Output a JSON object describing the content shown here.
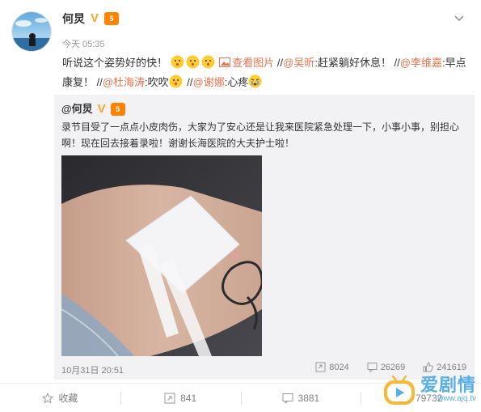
{
  "post": {
    "username": "何炅",
    "level_badge": "5",
    "time": "今天 05:35",
    "text_part1": "听说这个姿势好的快！",
    "view_pic": "查看图片",
    "seg2_prefix": " //",
    "mention1": "@吴昕",
    "seg2_text": ":赶紧躺好休息！ //",
    "mention2": "@李维嘉",
    "seg3_text": ":早点康复！ //",
    "mention3": "@杜海涛",
    "seg4_text": ":吹吹",
    "seg5_prefix": " //",
    "mention4": "@谢娜",
    "seg5_text": ":心疼"
  },
  "repost": {
    "username": "@何炅",
    "level_badge": "5",
    "text": "录节目受了一点点小皮肉伤，大家为了安心还是让我来医院紧急处理一下，小事小事，别担心啊！现在回去接着录啦！谢谢长海医院的大夫护士啦！",
    "time": "10月31日 20:51",
    "reposts": "8024",
    "comments": "26269",
    "likes": "241619"
  },
  "actions": {
    "favorite": "收藏",
    "repost": "841",
    "comment": "3881",
    "like": "79732"
  },
  "watermark": {
    "brand": "爱剧情",
    "site": "www.ajq.tv"
  },
  "colors": {
    "link": "#eb7350",
    "repost_bg": "#f2f2f5",
    "watermark": "#4aa8e8"
  }
}
